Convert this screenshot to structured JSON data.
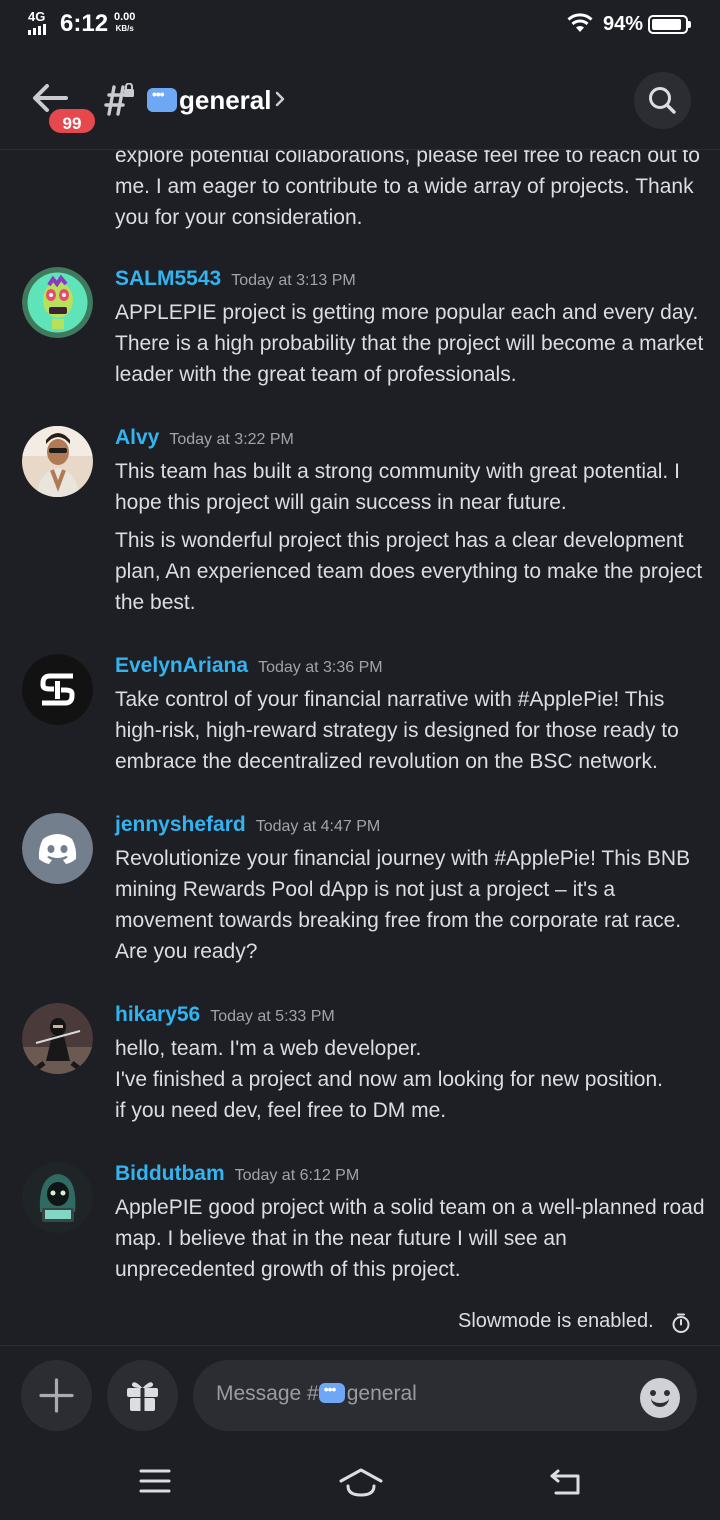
{
  "status_bar": {
    "network": "4G",
    "time": "6:12",
    "speed_value": "0.00",
    "speed_unit": "KB/s",
    "battery_percent": "94%"
  },
  "header": {
    "unread_badge": "99",
    "channel_name": "general",
    "icons": [
      "back-arrow-icon",
      "locked-hashtag-icon",
      "speech-balloon-emoji",
      "chevron-right-icon",
      "search-icon"
    ]
  },
  "messages": {
    "continuation_text": "explore potential collaborations, please feel free to reach out to me. I am eager to contribute to a wide array of projects. Thank you for your consideration.",
    "items": [
      {
        "username": "SALM5543",
        "timestamp": "Today at 3:13 PM",
        "lines": [
          "APPLEPIE project is getting more popular each and every day. There is a high probability that the project will become a market leader with the great team of professionals."
        ]
      },
      {
        "username": "Alvy",
        "timestamp": "Today at 3:22 PM",
        "lines": [
          "This team has built a strong community with great potential. I hope this project will gain success in near future.",
          "This is wonderful  project this project has a clear development plan, An experienced team does everything to make the project the best."
        ]
      },
      {
        "username": "EvelynAriana",
        "timestamp": "Today at 3:36 PM",
        "lines": [
          "Take control of your financial narrative with #ApplePie! This high-risk, high-reward strategy is designed for those ready to embrace the decentralized revolution on the BSC network."
        ]
      },
      {
        "username": "jennyshefard",
        "timestamp": "Today at 4:47 PM",
        "lines": [
          "Revolutionize your financial journey with #ApplePie! This BNB mining Rewards Pool dApp is not just a project – it's a movement towards breaking free from the corporate rat race. Are you ready?"
        ]
      },
      {
        "username": "hikary56",
        "timestamp": "Today at 5:33 PM",
        "lines": [
          "hello, team. I'm a web developer.",
          "I've finished a project and now am looking for new position.",
          "if you need dev, feel free to DM me."
        ]
      },
      {
        "username": "Biddutbam",
        "timestamp": "Today at 6:12 PM",
        "lines": [
          "ApplePIE good project with a solid team on a well-planned road map. I believe that in the near future I will see an unprecedented growth of this project."
        ]
      }
    ]
  },
  "slowmode_text": "Slowmode is enabled.",
  "composer": {
    "placeholder_prefix": "Message #",
    "placeholder_channel": "general"
  },
  "colors": {
    "background": "#1e1f24",
    "username": "#33b3f0",
    "badge": "#e5484d",
    "surface": "#2b2d33"
  }
}
